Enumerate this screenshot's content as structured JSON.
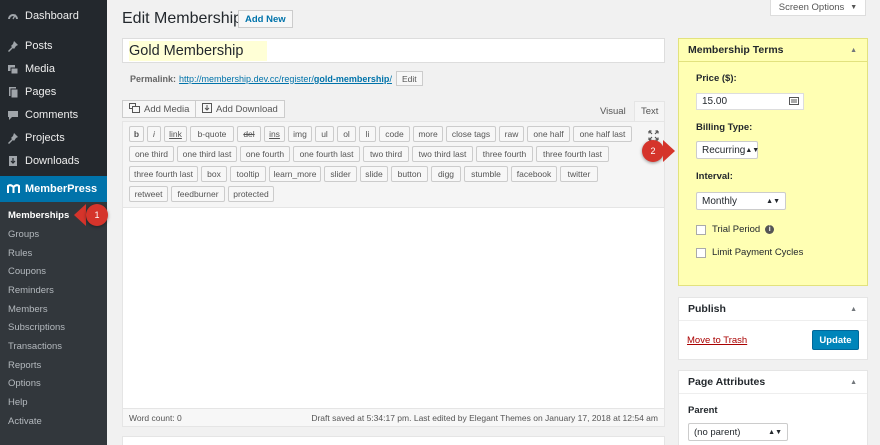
{
  "sidebar": {
    "items": [
      {
        "label": "Dashboard",
        "icon": "dashboard-icon"
      },
      {
        "label": "Posts",
        "icon": "pin-icon"
      },
      {
        "label": "Media",
        "icon": "media-icon"
      },
      {
        "label": "Pages",
        "icon": "pages-icon"
      },
      {
        "label": "Comments",
        "icon": "comments-icon"
      },
      {
        "label": "Projects",
        "icon": "pin-icon"
      },
      {
        "label": "Downloads",
        "icon": "download-icon"
      }
    ],
    "memberpress": {
      "label": "MemberPress",
      "icon": "memberpress-logo-icon"
    },
    "submenu": [
      "Memberships",
      "Groups",
      "Rules",
      "Coupons",
      "Reminders",
      "Members",
      "Subscriptions",
      "Transactions",
      "Reports",
      "Options",
      "Help",
      "Activate"
    ]
  },
  "badges": {
    "one": "1",
    "two": "2",
    "color": "#d5342b"
  },
  "header": {
    "screen_options": "Screen Options",
    "title": "Edit Membership",
    "add_new": "Add New"
  },
  "post": {
    "title": "Gold Membership",
    "permalink_label": "Permalink:",
    "permalink_base": "http://membership.dev.cc/register/",
    "permalink_slug": "gold-membership",
    "permalink_trail": "/",
    "edit_label": "Edit"
  },
  "editor": {
    "add_media": "Add Media",
    "add_download": "Add Download",
    "tab_visual": "Visual",
    "tab_text": "Text",
    "quicktags": [
      [
        "b",
        "i",
        "link",
        "b-quote",
        "del",
        "ins",
        "img",
        "ul",
        "ol",
        "li",
        "code",
        "more",
        "close tags",
        "raw",
        "one half",
        "one half last"
      ],
      [
        "one third",
        "one third last",
        "one fourth",
        "one fourth last",
        "two third",
        "two third last",
        "three fourth",
        "three fourth last"
      ],
      [
        "three fourth last",
        "box",
        "tooltip",
        "learn_more",
        "slider",
        "slide",
        "button",
        "digg",
        "stumble",
        "facebook",
        "twitter"
      ],
      [
        "retweet",
        "feedburner",
        "protected"
      ]
    ],
    "word_count": "Word count: 0",
    "draft_status": "Draft saved at 5:34:17 pm. Last edited by Elegant Themes on January 17, 2018 at 12:54 am"
  },
  "terms": {
    "title": "Membership Terms",
    "price_label": "Price ($):",
    "price_value": "15.00",
    "billing_label": "Billing Type:",
    "billing_value": "Recurring",
    "interval_label": "Interval:",
    "interval_value": "Monthly",
    "trial_label": "Trial Period",
    "limit_label": "Limit Payment Cycles",
    "highlight_color": "#ffffb3"
  },
  "publish": {
    "title": "Publish",
    "trash": "Move to Trash",
    "update": "Update"
  },
  "attributes": {
    "title": "Page Attributes",
    "parent_label": "Parent",
    "parent_value": "(no parent)"
  }
}
